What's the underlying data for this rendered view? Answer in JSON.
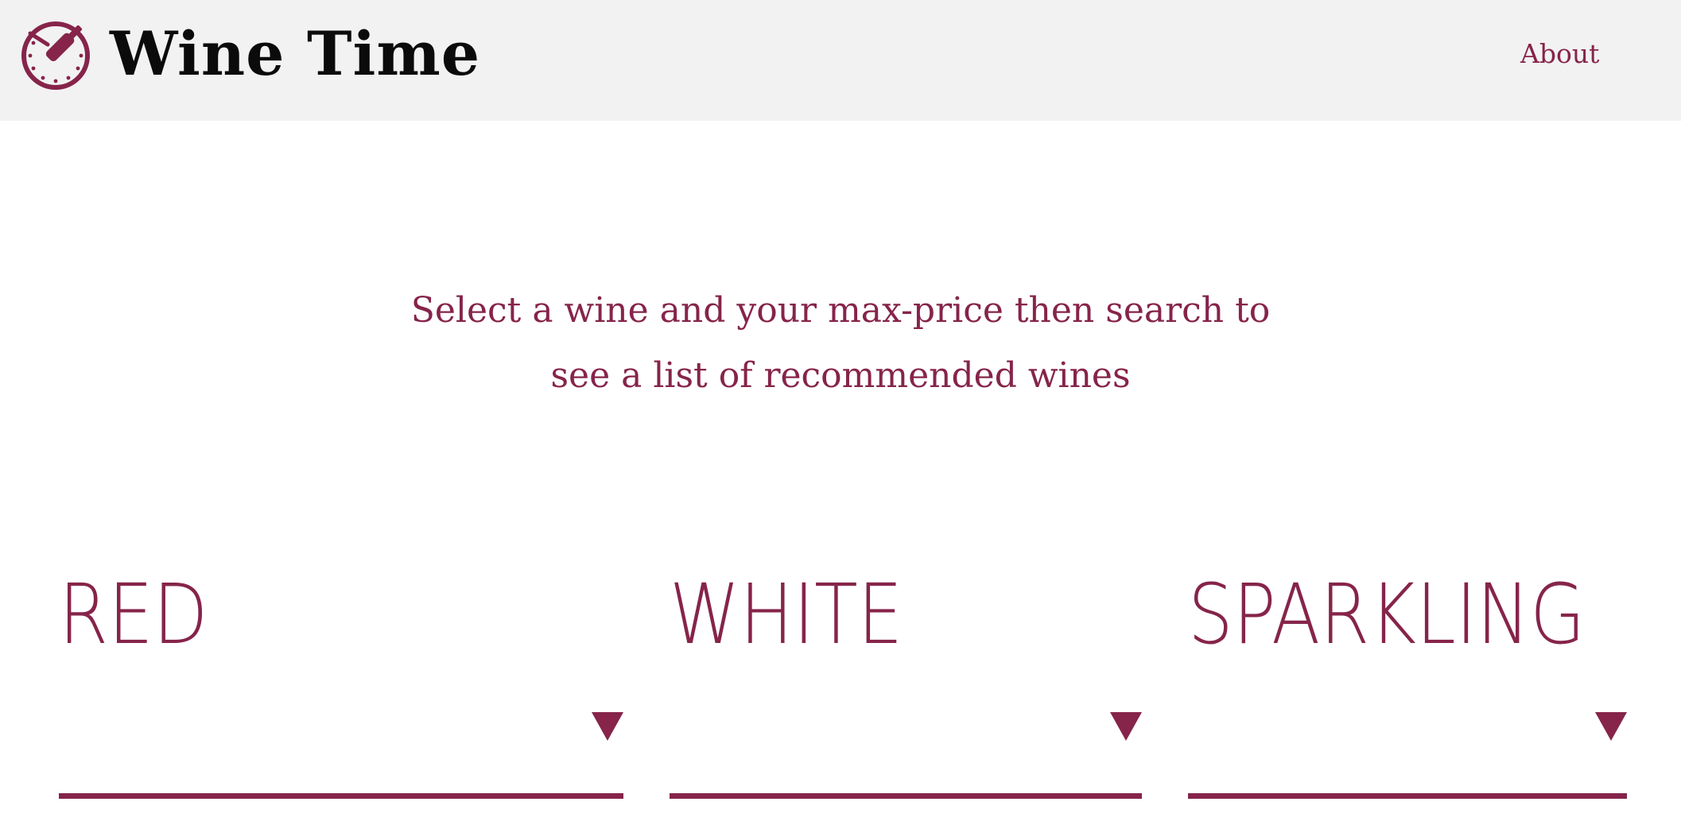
{
  "header": {
    "brand_title": "Wine Time",
    "logo_icon": "clock-wine-bottle-icon",
    "nav": {
      "about_label": "About"
    }
  },
  "intro": {
    "line1": "Select a wine and your max-price then search to",
    "line2": "see a list of recommended wines"
  },
  "wine_selects": [
    {
      "label": "RED",
      "selected_value": "",
      "icon": "dropdown-arrow-icon"
    },
    {
      "label": "WHITE",
      "selected_value": "",
      "icon": "dropdown-arrow-icon"
    },
    {
      "label": "SPARKLING",
      "selected_value": "",
      "icon": "dropdown-arrow-icon"
    }
  ],
  "colors": {
    "accent": "#86244a",
    "header_background": "#f2f2f2",
    "title_text": "#0b0b0b",
    "page_background": "#ffffff"
  }
}
